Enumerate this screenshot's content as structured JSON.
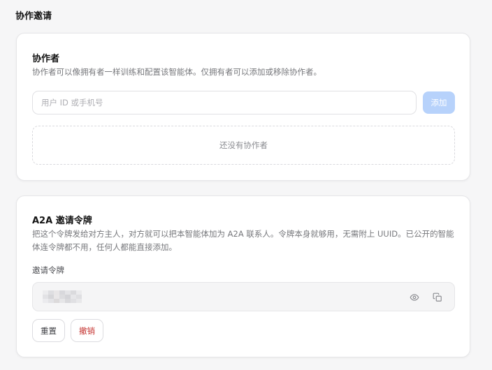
{
  "page": {
    "title": "协作邀请"
  },
  "collaborators": {
    "title": "协作者",
    "description": "协作者可以像拥有者一样训练和配置该智能体。仅拥有者可以添加或移除协作者。",
    "input_placeholder": "用户 ID 或手机号",
    "add_label": "添加",
    "empty_text": "还没有协作者"
  },
  "token": {
    "title": "A2A 邀请令牌",
    "description": "把这个令牌发给对方主人，对方就可以把本智能体加为 A2A 联系人。令牌本身就够用，无需附上 UUID。已公开的智能体连令牌都不用，任何人都能直接添加。",
    "field_label": "邀请令牌",
    "reset_label": "重置",
    "revoke_label": "撤销"
  },
  "colors": {
    "accent_disabled": "#b7d2fb",
    "danger": "#c4322f"
  },
  "icons": {
    "reveal": "eye-icon",
    "copy": "copy-icon"
  }
}
